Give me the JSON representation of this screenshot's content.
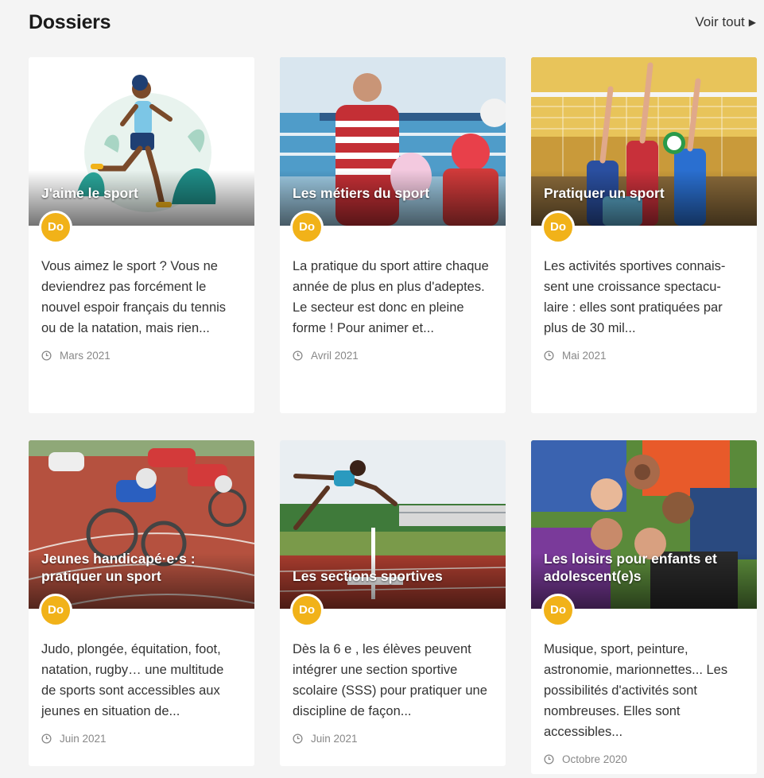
{
  "header": {
    "title": "Dossiers",
    "see_all": "Voir tout"
  },
  "cards": [
    {
      "caption": "J'aime le sport",
      "badge": "Do",
      "description": "Vous aimez le sport ? Vous ne deviendrez pas forcément le nouvel espoir français du tennis ou de la natation, mais rien...",
      "date": "Mars 2021"
    },
    {
      "caption": "Les métiers du sport",
      "badge": "Do",
      "description": "La pratique du sport attire chaque année de plus en plus d'adeptes. Le secteur est donc en pleine forme ! Pour animer et...",
      "date": "Avril 2021"
    },
    {
      "caption": "Pratiquer un sport",
      "badge": "Do",
      "description": "Les activités sportives connais-sent une croissance spectacu-laire : elles sont pratiquées par plus de 30 mil...",
      "date": "Mai 2021"
    },
    {
      "caption": "Jeunes handicapé·e·s : pratiquer un sport",
      "badge": "Do",
      "description": "Judo, plongée, équitation, foot, natation, rugby… une multitude de sports sont accessibles aux jeunes en situation de...",
      "date": "Juin 2021"
    },
    {
      "caption": "Les sections sportives",
      "badge": "Do",
      "description": "Dès la 6 e , les élèves peuvent intégrer une section sportive scolaire (SSS) pour pratiquer une discipline de façon...",
      "date": "Juin 2021"
    },
    {
      "caption": "Les loisirs pour enfants et adolescent(e)s",
      "badge": "Do",
      "description": "Musique, sport, peinture, astronomie, marionnettes... Les possibilités d'activités sont nombreuses. Elles sont accessibles...",
      "date": "Octobre 2020"
    }
  ]
}
